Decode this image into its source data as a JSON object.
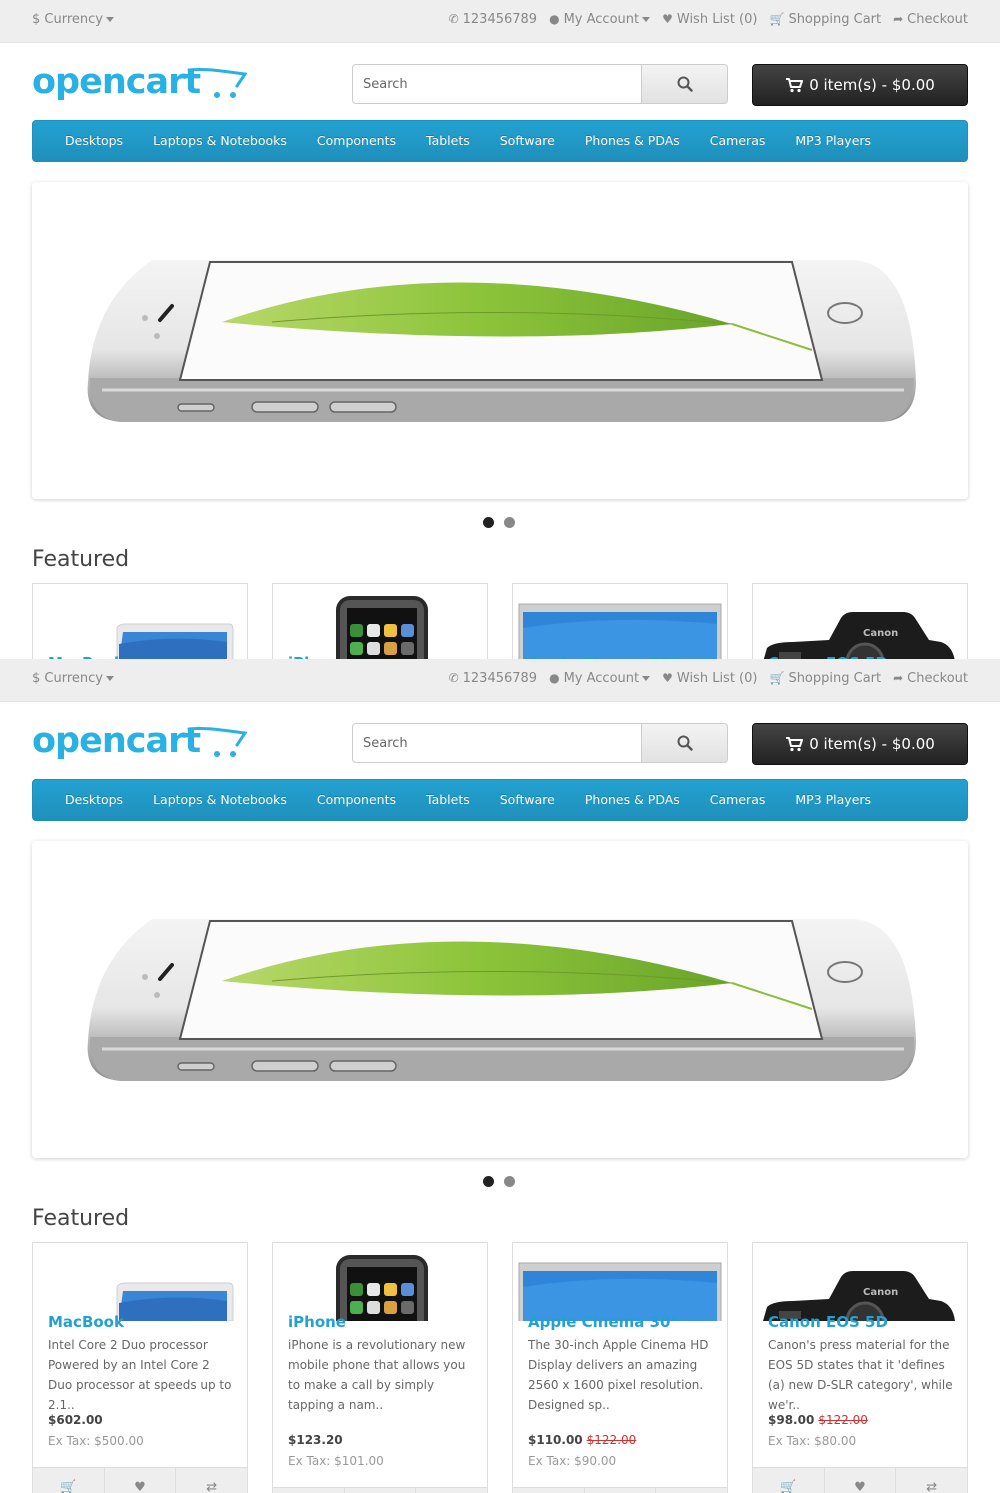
{
  "topbar": {
    "currency": "$ Currency",
    "phone": "123456789",
    "my_account": "My Account",
    "wishlist": "Wish List (0)",
    "shopping_cart": "Shopping Cart",
    "checkout": "Checkout"
  },
  "header": {
    "logo_text": "opencart",
    "search_placeholder": "Search",
    "cart_label": "0 item(s) - $0.00"
  },
  "menu": [
    "Desktops",
    "Laptops & Notebooks",
    "Components",
    "Tablets",
    "Software",
    "Phones & PDAs",
    "Cameras",
    "MP3 Players"
  ],
  "slideshow": {
    "slides": 2,
    "active": 1
  },
  "featured_title": "Featured",
  "products": [
    {
      "name": "MacBook",
      "description": "Intel Core 2 Duo processor Powered by an Intel Core 2 Duo processor at speeds up to 2.1..",
      "price": "$602.00",
      "old_price": "",
      "ex_tax": "Ex Tax: $500.00",
      "image": "laptop"
    },
    {
      "name": "iPhone",
      "description": "iPhone is a revolutionary new mobile phone that allows you to make a call by simply tapping a nam..",
      "price": "$123.20",
      "old_price": "",
      "ex_tax": "Ex Tax: $101.00",
      "image": "phone"
    },
    {
      "name": "Apple Cinema 30\"",
      "description": "The 30-inch Apple Cinema HD Display delivers an amazing 2560 x 1600 pixel resolution. Designed sp..",
      "price": "$110.00",
      "old_price": "$122.00",
      "ex_tax": "Ex Tax: $90.00",
      "image": "monitor"
    },
    {
      "name": "Canon EOS 5D",
      "description": "Canon's press material for the EOS 5D states that it 'defines (a) new D-SLR category', while we'r..",
      "price": "$98.00",
      "old_price": "$122.00",
      "ex_tax": "Ex Tax: $80.00",
      "image": "camera"
    }
  ],
  "colors": {
    "accent": "#23a1d1",
    "menu": "#229ac8",
    "cart": "#333333",
    "old_price": "#cc3333"
  },
  "icons": {
    "phone": "phone-icon",
    "account": "user-icon",
    "wishlist": "heart-icon",
    "cart": "cart-icon",
    "checkout": "share-icon",
    "search": "search-icon"
  }
}
